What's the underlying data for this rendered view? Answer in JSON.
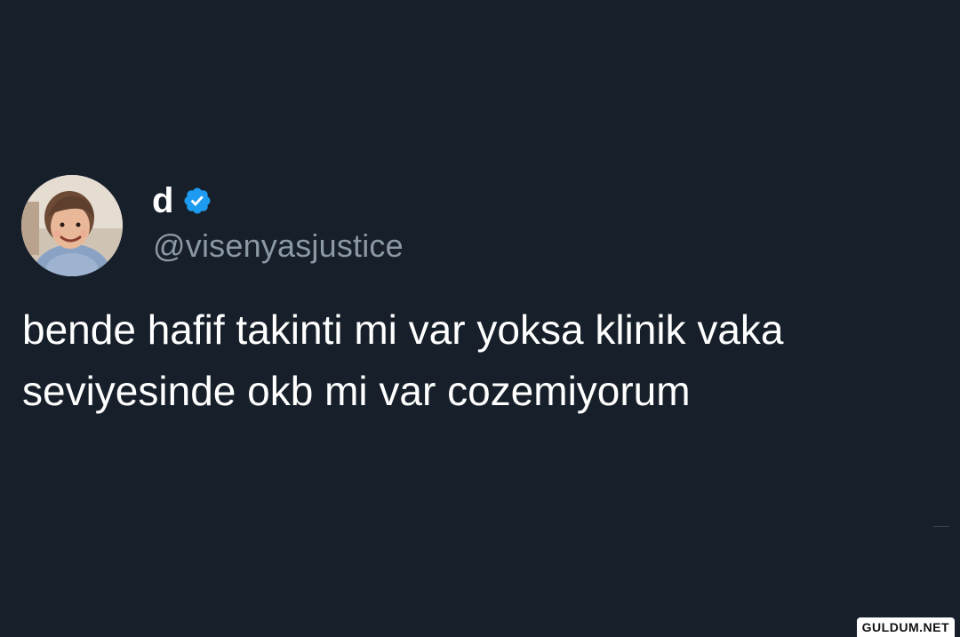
{
  "tweet": {
    "display_name": "d",
    "handle": "@visenyasjustice",
    "text": "bende hafif takinti mi var yoksa klinik vaka seviyesinde okb mi var cozemiyorum",
    "verified_icon": "verified-badge-icon",
    "avatar": "profile-photo"
  },
  "watermark": {
    "text": "GULDUM.NET"
  },
  "colors": {
    "background": "#17202a",
    "text": "#ffffff",
    "handle": "#8b98a5",
    "verified": "#1d9bf0"
  }
}
